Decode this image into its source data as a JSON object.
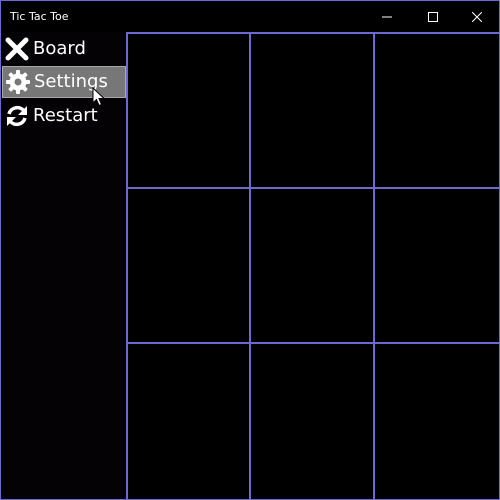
{
  "window": {
    "title": "Tic Tac Toe",
    "caption_icons": [
      "minimize-icon",
      "maximize-icon",
      "close-icon"
    ]
  },
  "sidebar": {
    "items": [
      {
        "label": "Board",
        "icon": "x-mark-icon",
        "selected": false
      },
      {
        "label": "Settings",
        "icon": "gear-icon",
        "selected": true
      },
      {
        "label": "Restart",
        "icon": "refresh-icon",
        "selected": false
      }
    ]
  },
  "board": {
    "rows": 3,
    "cols": 3,
    "cells": [
      "",
      "",
      "",
      "",
      "",
      "",
      "",
      "",
      ""
    ]
  },
  "colors": {
    "grid_line": "#6a6ad0",
    "background": "#000000",
    "selected_item": "#777777"
  }
}
